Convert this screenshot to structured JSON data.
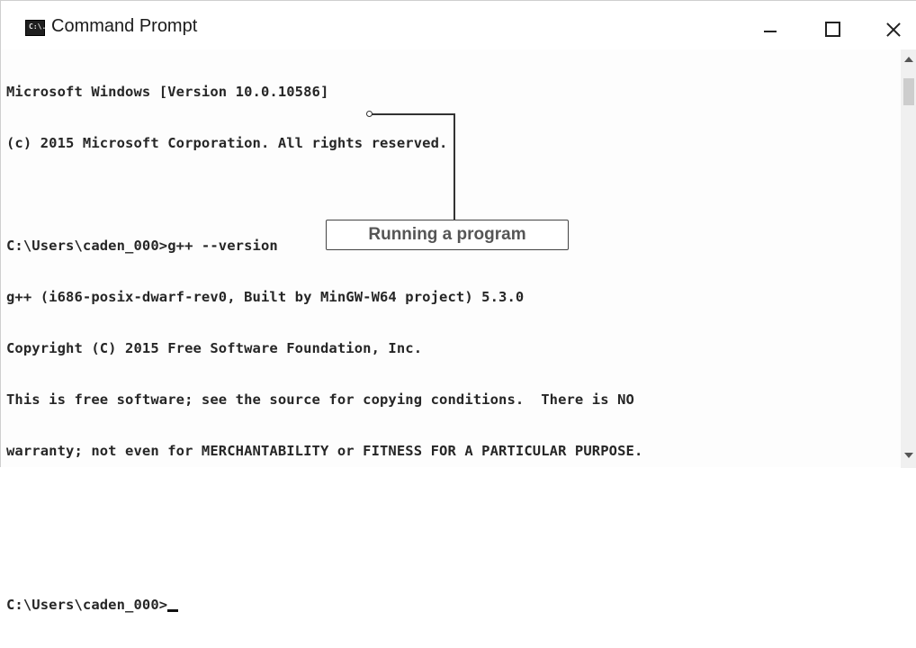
{
  "window": {
    "title": "Command Prompt",
    "icon": "cmd-icon",
    "icon_text": "C:\\."
  },
  "console": {
    "lines": [
      "Microsoft Windows [Version 10.0.10586]",
      "(c) 2015 Microsoft Corporation. All rights reserved.",
      "",
      "C:\\Users\\caden_000>g++ --version",
      "g++ (i686-posix-dwarf-rev0, Built by MinGW-W64 project) 5.3.0",
      "Copyright (C) 2015 Free Software Foundation, Inc.",
      "This is free software; see the source for copying conditions.  There is NO",
      "warranty; not even for MERCHANTABILITY or FITNESS FOR A PARTICULAR PURPOSE.",
      "",
      ""
    ],
    "prompt": "C:\\Users\\caden_000>"
  },
  "callout": {
    "label": "Running a program"
  },
  "colors": {
    "console_bg": "#fdfdfd",
    "console_text": "#262626",
    "callout_text": "#555555"
  }
}
